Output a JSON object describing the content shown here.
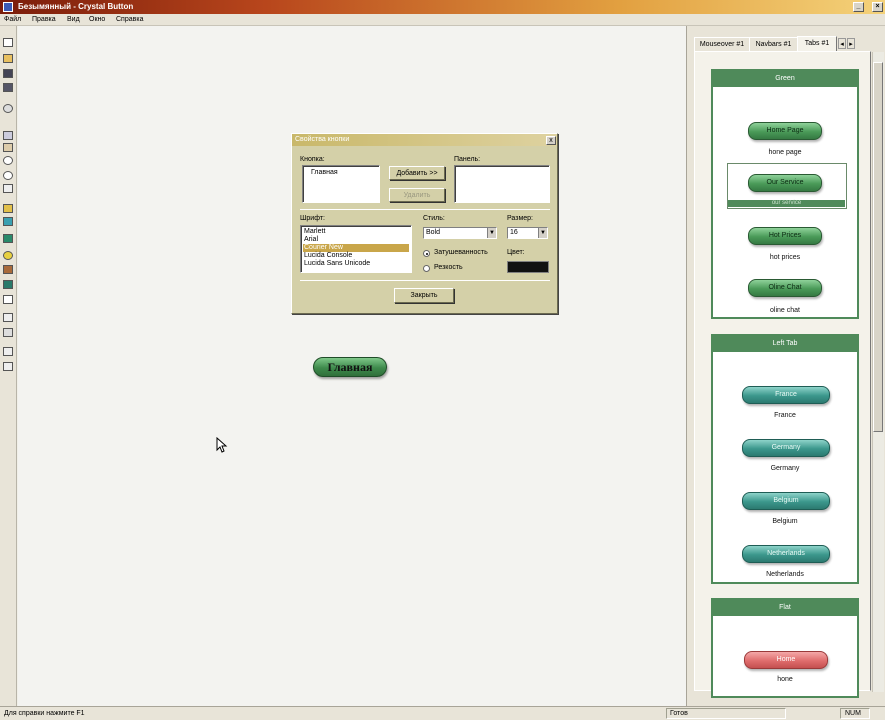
{
  "window": {
    "title": "Безымянный - Crystal Button",
    "minimize": "_",
    "maximize": "□",
    "close": "×"
  },
  "menu": [
    "Файл",
    "Правка",
    "Вид",
    "Окно",
    "Справка"
  ],
  "toolbar_icons": [
    "new-icon",
    "open-icon",
    "save-icon",
    "save-all-icon",
    "undo-icon",
    "copy-icon",
    "paste-icon",
    "zoom-in-icon",
    "zoom-out-icon",
    "pointer-icon",
    "pen-icon",
    "color-icon",
    "fill-icon",
    "bulb-icon",
    "layer-icon",
    "frame-icon",
    "chart-icon",
    "arrows-icon",
    "home-icon",
    "help-icon"
  ],
  "canvas": {
    "button_label": "Главная"
  },
  "dialog": {
    "title": "Свойства кнопки",
    "close": "x",
    "button_label": "Кнопка:",
    "button_list": [
      "Главная"
    ],
    "add_button": "Добавить >>",
    "remove_button": "Удалить",
    "panel_label": "Панель:",
    "font_label": "Шрифт:",
    "fonts": [
      "Marlett",
      "Arial",
      "Courier New",
      "Lucida Console",
      "Lucida Sans Unicode"
    ],
    "selected_font": "Courier New",
    "style_label": "Стиль:",
    "style_value": "Bold",
    "size_label": "Размер:",
    "size_value": "16",
    "shading_label": "Затушеванность",
    "sharpness_label": "Резкость",
    "color_label": "Цвет:",
    "color_value": "#111111",
    "close_button": "Закрыть"
  },
  "right_panel": {
    "tabs": [
      "Mouseover #1",
      "Navbars #1",
      "Tabs #1"
    ],
    "active_tab": "Tabs #1",
    "groups": [
      {
        "title": "Green",
        "items": [
          {
            "button": "Home Page",
            "caption": "hone page"
          },
          {
            "button": "Our Service",
            "caption": "our service"
          },
          {
            "button": "Hot Prices",
            "caption": "hot prices"
          },
          {
            "button": "Oline Chat",
            "caption": "oline chat"
          }
        ]
      },
      {
        "title": "Left Tab",
        "items": [
          {
            "button": "France",
            "caption": "France"
          },
          {
            "button": "Germany",
            "caption": "Germany"
          },
          {
            "button": "Belgium",
            "caption": "Belgium"
          },
          {
            "button": "Netherlands",
            "caption": "Netherlands"
          }
        ]
      },
      {
        "title": "Flat",
        "items": [
          {
            "button": "Home",
            "caption": "hone"
          }
        ]
      }
    ]
  },
  "status": {
    "hint": "Для справки нажмите F1",
    "ready": "Готов",
    "num": "NUM"
  }
}
